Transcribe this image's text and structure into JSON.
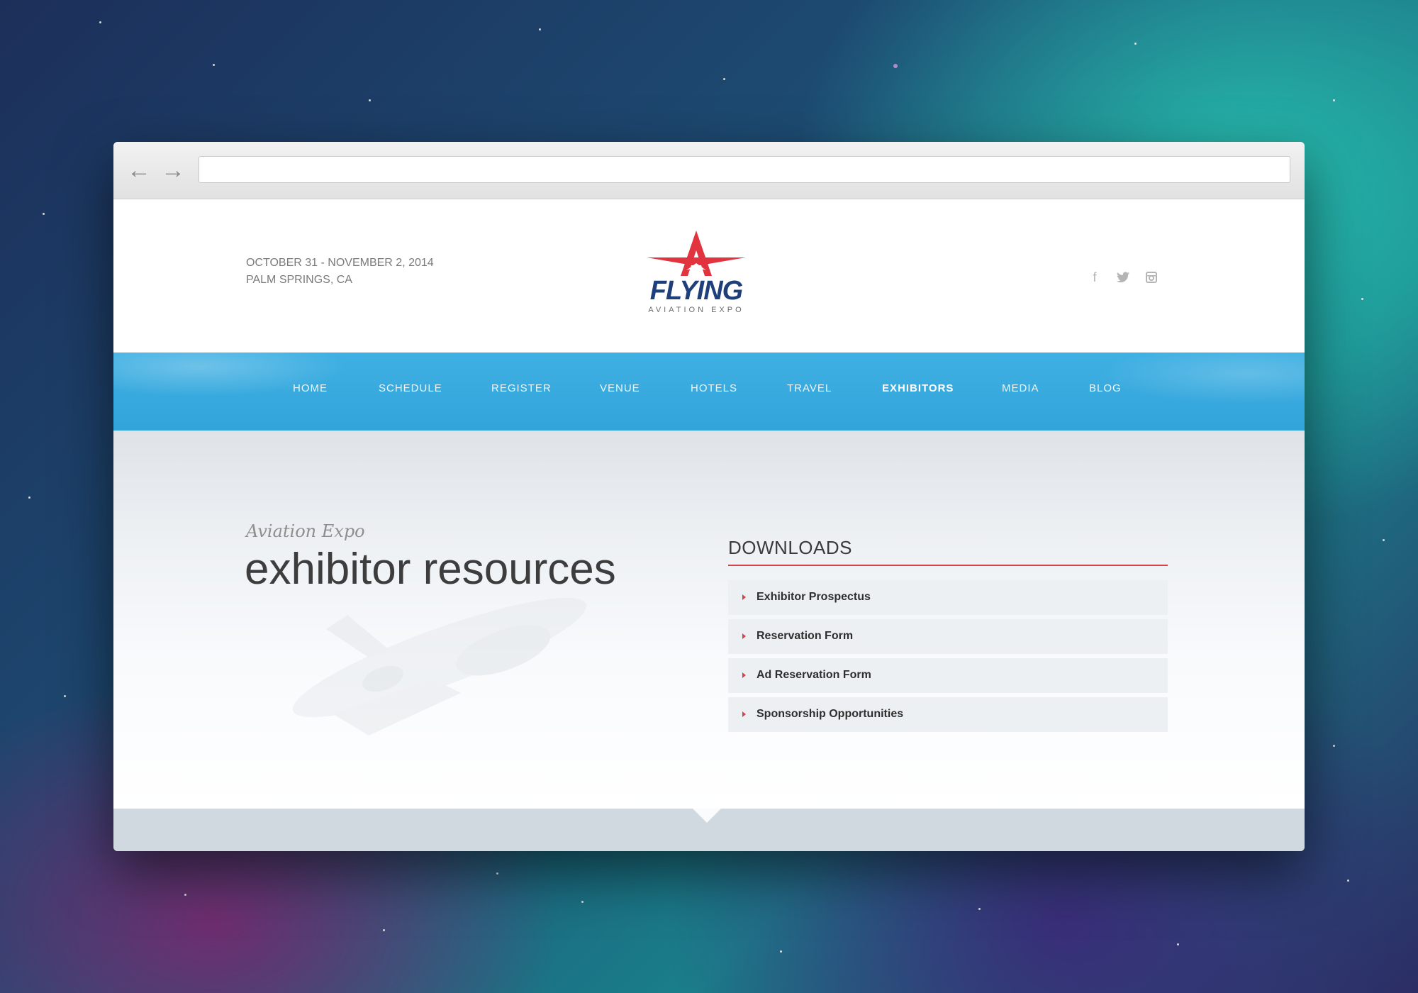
{
  "browser": {
    "back_icon": "arrow-left-icon",
    "forward_icon": "arrow-right-icon",
    "url_value": ""
  },
  "header": {
    "date_line": "OCTOBER 31 - NOVEMBER 2, 2014",
    "location_line": "PALM SPRINGS, CA",
    "logo_word": "FLYING",
    "logo_sub": "AVIATION EXPO",
    "social": [
      {
        "icon": "facebook-icon",
        "glyph": "f"
      },
      {
        "icon": "twitter-icon",
        "glyph": "🐦"
      },
      {
        "icon": "instagram-icon",
        "glyph": "◙"
      }
    ]
  },
  "nav": {
    "items": [
      {
        "label": "HOME"
      },
      {
        "label": "SCHEDULE"
      },
      {
        "label": "REGISTER"
      },
      {
        "label": "VENUE"
      },
      {
        "label": "HOTELS"
      },
      {
        "label": "TRAVEL"
      },
      {
        "label": "EXHIBITORS"
      },
      {
        "label": "MEDIA"
      },
      {
        "label": "BLOG"
      }
    ],
    "active": "EXHIBITORS"
  },
  "main": {
    "subtitle": "Aviation Expo",
    "title": "exhibitor resources",
    "downloads": {
      "heading": "DOWNLOADS",
      "items": [
        {
          "label": "Exhibitor Prospectus"
        },
        {
          "label": "Reservation Form"
        },
        {
          "label": "Ad Reservation Form"
        },
        {
          "label": "Sponsorship Opportunities"
        }
      ]
    }
  },
  "colors": {
    "accent_red": "#d3434d",
    "nav_blue": "#3aaae0",
    "logo_navy": "#1f3f7a"
  }
}
